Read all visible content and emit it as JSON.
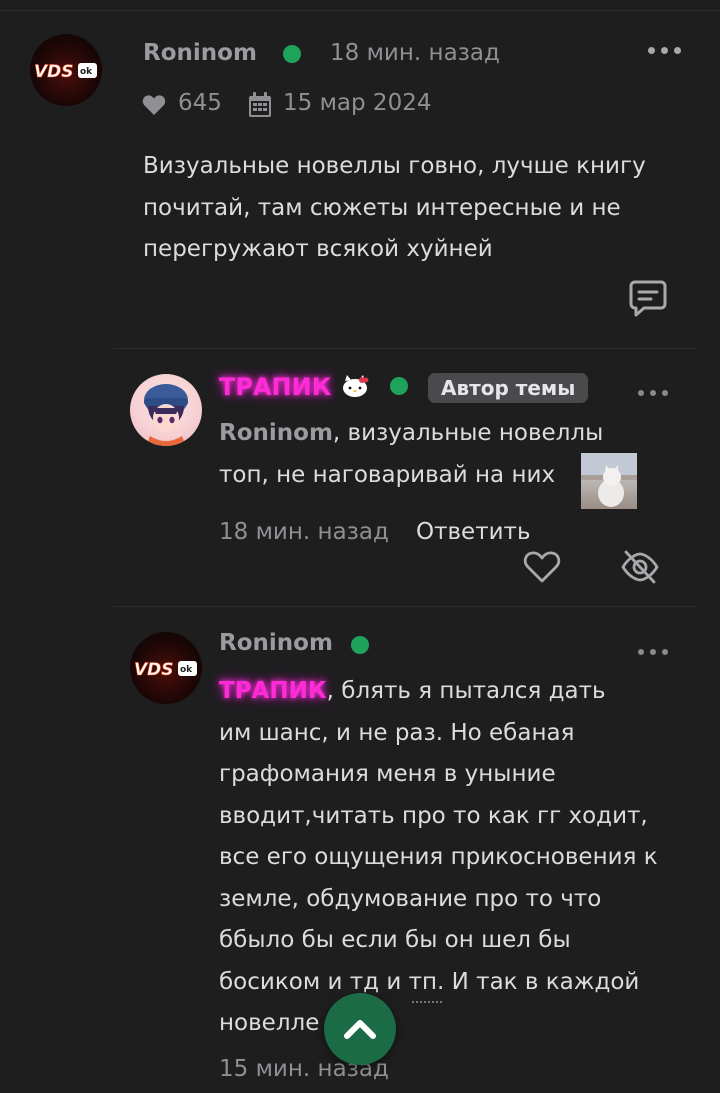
{
  "comment_main": {
    "author": "Roninom",
    "avatar_text": "VDS",
    "avatar_badge": "ok",
    "time": "18 мин. назад",
    "likes": "645",
    "date": "15 мар 2024",
    "text_lines": [
      "Визуальные новеллы говно, лучше книгу",
      "почитай, там сюжеты интересные и не",
      "перегружают всякой хуйней"
    ]
  },
  "reply_1": {
    "author": "ТРАПИК",
    "badge": "Автор темы",
    "mention": "Roninom",
    "text_first": ", визуальные новеллы",
    "text_second": "топ, не наговаривай на них",
    "time": "18 мин. назад",
    "reply_label": "Ответить"
  },
  "reply_2": {
    "author": "Roninom",
    "avatar_text": "VDS",
    "avatar_badge": "ok",
    "mention": "ТРАПИК",
    "text_first": ", блять я пытался дать",
    "text_lines": [
      "им шанс, и не раз. Но ебаная",
      "графомания меня в уныние",
      "вводит,читать про то как гг ходит,",
      "все его ощущения прикосновения к",
      "земле, обдумование про то что",
      "ббыло бы если бы он шел бы",
      "босиком и тд и тп. И так в каждой",
      "новелле"
    ],
    "time": "15 мин. назад"
  },
  "colors": {
    "background": "#1e1e1f",
    "online": "#1fa25a",
    "neon_name": "#ff2bd6",
    "scroll_button": "#1c6b47"
  },
  "icons": [
    "heart-icon",
    "calendar-icon",
    "comment-reply-icon",
    "hello-kitty-icon",
    "eye-off-icon",
    "chevron-up-icon",
    "more-icon"
  ]
}
